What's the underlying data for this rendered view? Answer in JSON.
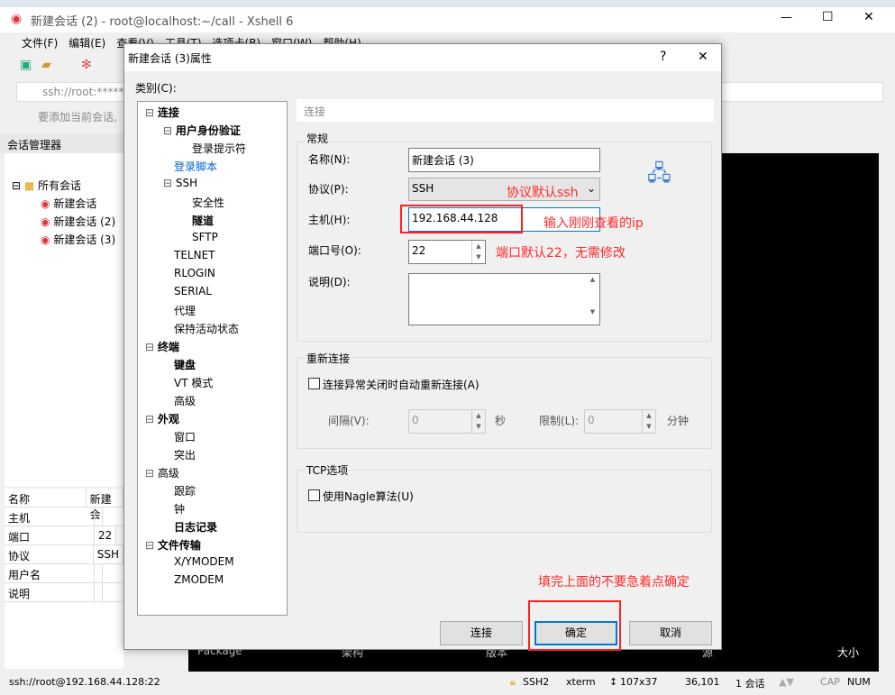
{
  "window": {
    "title": "新建会话 (2) - root@localhost:~/call - Xshell 6",
    "minimize": "—",
    "maximize": "☐",
    "close": "✕"
  },
  "menu": [
    "文件(F)",
    "编辑(E)",
    "查看(V)",
    "工具(T)",
    "选项卡(B)",
    "窗口(W)",
    "帮助(H)"
  ],
  "address": "ssh://root:******",
  "hint": "要添加当前会话,",
  "session_manager": {
    "title": "会话管理器",
    "root": "所有会话",
    "items": [
      "新建会话",
      "新建会话 (2)",
      "新建会话 (3)"
    ]
  },
  "properties": [
    [
      "名称",
      "新建会"
    ],
    [
      "主机",
      ""
    ],
    [
      "端口",
      "22"
    ],
    [
      "协议",
      "SSH"
    ],
    [
      "用户名",
      ""
    ],
    [
      "说明",
      ""
    ]
  ],
  "terminal": {
    "col1": "Package",
    "col2": "架构",
    "col3": "版本",
    "col4": "源",
    "col5": "大小"
  },
  "statusbar": {
    "address": "ssh://root@192.168.44.128:22",
    "protocol": "SSH2",
    "term": "xterm",
    "size": "107x37",
    "pos": "36,101",
    "sessions": "1 会话",
    "cap": "CAP",
    "num": "NUM"
  },
  "dialog": {
    "title": "新建会话 (3)属性",
    "help": "?",
    "close": "✕",
    "category_label": "类别(C):",
    "tree": [
      {
        "label": "连接",
        "level": 0,
        "bold": true,
        "exp": "⊟"
      },
      {
        "label": "用户身份验证",
        "level": 1,
        "bold": true,
        "exp": "⊟"
      },
      {
        "label": "登录提示符",
        "level": 2
      },
      {
        "label": "登录脚本",
        "level": 1,
        "link": true
      },
      {
        "label": "SSH",
        "level": 1,
        "exp": "⊟"
      },
      {
        "label": "安全性",
        "level": 2
      },
      {
        "label": "隧道",
        "level": 2,
        "bold": true
      },
      {
        "label": "SFTP",
        "level": 2
      },
      {
        "label": "TELNET",
        "level": 1
      },
      {
        "label": "RLOGIN",
        "level": 1
      },
      {
        "label": "SERIAL",
        "level": 1
      },
      {
        "label": "代理",
        "level": 1
      },
      {
        "label": "保持活动状态",
        "level": 1
      },
      {
        "label": "终端",
        "level": 0,
        "bold": true,
        "exp": "⊟"
      },
      {
        "label": "键盘",
        "level": 1,
        "bold": true
      },
      {
        "label": "VT 模式",
        "level": 1
      },
      {
        "label": "高级",
        "level": 1
      },
      {
        "label": "外观",
        "level": 0,
        "bold": true,
        "exp": "⊟"
      },
      {
        "label": "窗口",
        "level": 1
      },
      {
        "label": "突出",
        "level": 1
      },
      {
        "label": "高级",
        "level": 0,
        "exp": "⊟"
      },
      {
        "label": "跟踪",
        "level": 1
      },
      {
        "label": "钟",
        "level": 1
      },
      {
        "label": "日志记录",
        "level": 1,
        "bold": true
      },
      {
        "label": "文件传输",
        "level": 0,
        "bold": true,
        "exp": "⊟"
      },
      {
        "label": "X/YMODEM",
        "level": 1
      },
      {
        "label": "ZMODEM",
        "level": 1
      }
    ],
    "section_header": "连接",
    "general": {
      "title": "常规",
      "name_label": "名称(N):",
      "name_value": "新建会话 (3)",
      "protocol_label": "协议(P):",
      "protocol_value": "SSH",
      "host_label": "主机(H):",
      "host_value": "192.168.44.128",
      "port_label": "端口号(O):",
      "port_value": "22",
      "desc_label": "说明(D):",
      "desc_value": ""
    },
    "reconnect": {
      "title": "重新连接",
      "checkbox": "连接异常关闭时自动重新连接(A)",
      "checked": false,
      "interval_label": "间隔(V):",
      "interval_value": "0",
      "sec": "秒",
      "limit_label": "限制(L):",
      "limit_value": "0",
      "min": "分钟"
    },
    "tcp": {
      "title": "TCP选项",
      "checkbox": "使用Nagle算法(U)",
      "checked": false
    },
    "buttons": {
      "connect": "连接",
      "ok": "确定",
      "cancel": "取消"
    }
  },
  "annotations": {
    "protocol": "协议默认ssh",
    "host": "输入刚刚查看的ip",
    "port": "端口默认22，无需修改",
    "ok": "填完上面的不要急着点确定"
  },
  "colors": {
    "annotation": "#ff2a2a",
    "ok_focus": "#0078d7",
    "link": "#0066cc"
  }
}
